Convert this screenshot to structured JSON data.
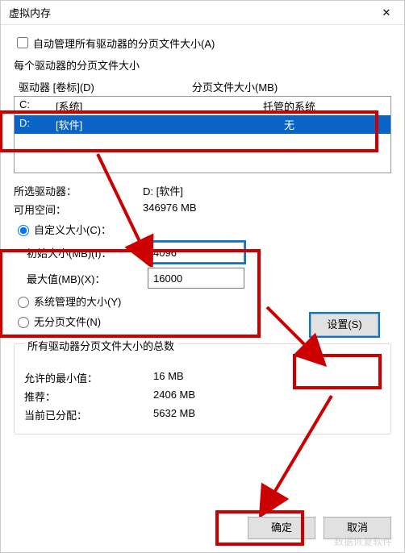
{
  "titlebar": {
    "title": "虚拟内存",
    "close_glyph": "✕"
  },
  "auto_manage": {
    "label": "自动管理所有驱动器的分页文件大小(A)",
    "checked": false
  },
  "drives": {
    "section_label": "每个驱动器的分页文件大小",
    "header_drive": "驱动器 [卷标](D)",
    "header_size": "分页文件大小(MB)",
    "rows": [
      {
        "letter": "C:",
        "volume": "[系统]",
        "size": "托管的系统",
        "selected": false
      },
      {
        "letter": "D:",
        "volume": "[软件]",
        "size": "无",
        "selected": true
      }
    ]
  },
  "selected_info": {
    "drive_label": "所选驱动器：",
    "drive_value": "D:  [软件]",
    "space_label": "可用空间：",
    "space_value": "346976 MB"
  },
  "options": {
    "custom_label": "自定义大小(C)：",
    "initial_label": "初始大小(MB)(I)：",
    "initial_value": "4096",
    "max_label": "最大值(MB)(X)：",
    "max_value": "16000",
    "system_managed_label": "系统管理的大小(Y)",
    "no_paging_label": "无分页文件(N)",
    "selected": "custom"
  },
  "set_button": "设置(S)",
  "totals": {
    "group_title": "所有驱动器分页文件大小的总数",
    "min_label": "允许的最小值：",
    "min_value": "16 MB",
    "rec_label": "推荐：",
    "rec_value": "2406 MB",
    "cur_label": "当前已分配：",
    "cur_value": "5632 MB"
  },
  "footer": {
    "ok": "确定",
    "cancel": "取消"
  },
  "watermark": "数据恢复软件"
}
